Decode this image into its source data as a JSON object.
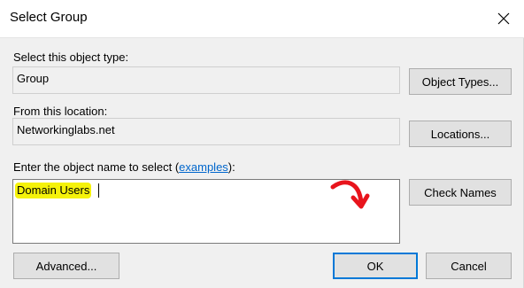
{
  "window": {
    "title": "Select Group"
  },
  "object_type": {
    "label": "Select this object type:",
    "value": "Group",
    "button_label": "Object Types..."
  },
  "location": {
    "label": "From this location:",
    "value": "Networkinglabs.net",
    "button_label": "Locations..."
  },
  "object_name": {
    "label_prefix": "Enter the object name to select (",
    "link_text": "examples",
    "label_suffix": "):",
    "value": "Domain Users",
    "button_label": "Check Names",
    "highlight_color": "#f5f20a"
  },
  "footer": {
    "advanced_label": "Advanced...",
    "ok_label": "OK",
    "cancel_label": "Cancel"
  },
  "colors": {
    "link": "#0066cc",
    "default_button_border": "#0078d7",
    "annotation_arrow": "#e8141c"
  }
}
